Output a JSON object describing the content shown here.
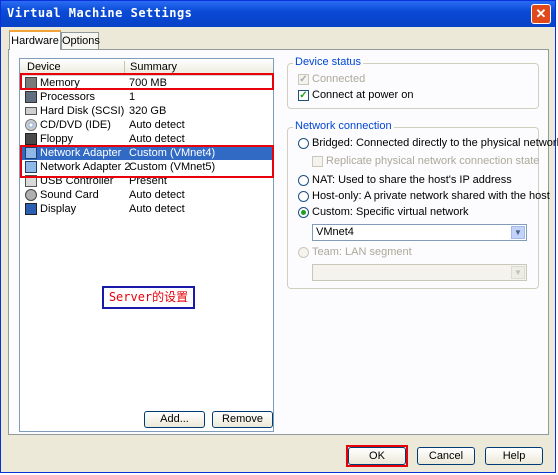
{
  "window": {
    "title": "Virtual Machine Settings",
    "close_glyph": "✕"
  },
  "tabs": [
    {
      "label": "Hardware"
    },
    {
      "label": "Options"
    }
  ],
  "device_list": {
    "headers": {
      "device": "Device",
      "summary": "Summary"
    },
    "rows": [
      {
        "device": "Memory",
        "summary": "700 MB",
        "icon": "memory-icon"
      },
      {
        "device": "Processors",
        "summary": "1",
        "icon": "processor-icon"
      },
      {
        "device": "Hard Disk (SCSI)",
        "summary": "320 GB",
        "icon": "hard-disk-icon"
      },
      {
        "device": "CD/DVD (IDE)",
        "summary": "Auto detect",
        "icon": "cd-dvd-icon"
      },
      {
        "device": "Floppy",
        "summary": "Auto detect",
        "icon": "floppy-icon"
      },
      {
        "device": "Network Adapter",
        "summary": "Custom (VMnet4)",
        "icon": "network-adapter-icon",
        "selected": true
      },
      {
        "device": "Network Adapter 2",
        "summary": "Custom (VMnet5)",
        "icon": "network-adapter-icon"
      },
      {
        "device": "USB Controller",
        "summary": "Present",
        "icon": "usb-icon"
      },
      {
        "device": "Sound Card",
        "summary": "Auto detect",
        "icon": "sound-card-icon"
      },
      {
        "device": "Display",
        "summary": "Auto detect",
        "icon": "display-icon"
      }
    ]
  },
  "annotation": {
    "text": "Server的设置",
    "text_color": "#e8000b",
    "border_color": "#1a1aa8"
  },
  "highlight_color": "#e8000b",
  "buttons": {
    "add": "Add...",
    "remove": "Remove",
    "ok": "OK",
    "cancel": "Cancel",
    "help": "Help"
  },
  "device_status": {
    "title": "Device status",
    "connected": {
      "label": "Connected",
      "checked": true,
      "disabled": true
    },
    "connect_at_power_on": {
      "label": "Connect at power on",
      "checked": true
    }
  },
  "network_connection": {
    "title": "Network connection",
    "bridged": {
      "label": "Bridged: Connected directly to the physical network",
      "selected": false
    },
    "replicate": {
      "label": "Replicate physical network connection state",
      "checked": false,
      "disabled": true
    },
    "nat": {
      "label": "NAT: Used to share the host's IP address",
      "selected": false
    },
    "host_only": {
      "label": "Host-only: A private network shared with the host",
      "selected": false
    },
    "custom": {
      "label": "Custom: Specific virtual network",
      "selected": true
    },
    "custom_network_value": "VMnet4",
    "team": {
      "label": "Team: LAN segment",
      "selected": false,
      "disabled": true
    },
    "team_value": ""
  }
}
